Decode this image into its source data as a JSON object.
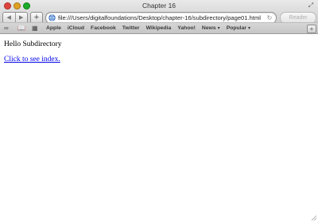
{
  "window": {
    "title": "Chapter 16"
  },
  "toolbar": {
    "back_label": "◀",
    "forward_label": "▶",
    "add_label": "+",
    "url": "file:///Users/digitalfoundations/Desktop/chapter-16/subdirectory/page01.html",
    "reload_label": "↻",
    "reader_label": "Reader"
  },
  "bookmarks": {
    "items": [
      {
        "label": "Apple"
      },
      {
        "label": "iCloud"
      },
      {
        "label": "Facebook"
      },
      {
        "label": "Twitter"
      },
      {
        "label": "Wikipedia"
      },
      {
        "label": "Yahoo!"
      },
      {
        "label": "News",
        "caret": "▾"
      },
      {
        "label": "Popular",
        "caret": "▾"
      }
    ],
    "icons": [
      "reading-list-icon",
      "bookmarks-icon",
      "top-sites-icon"
    ]
  },
  "page": {
    "text": "Hello Subdirectory",
    "link": "Click to see index."
  }
}
